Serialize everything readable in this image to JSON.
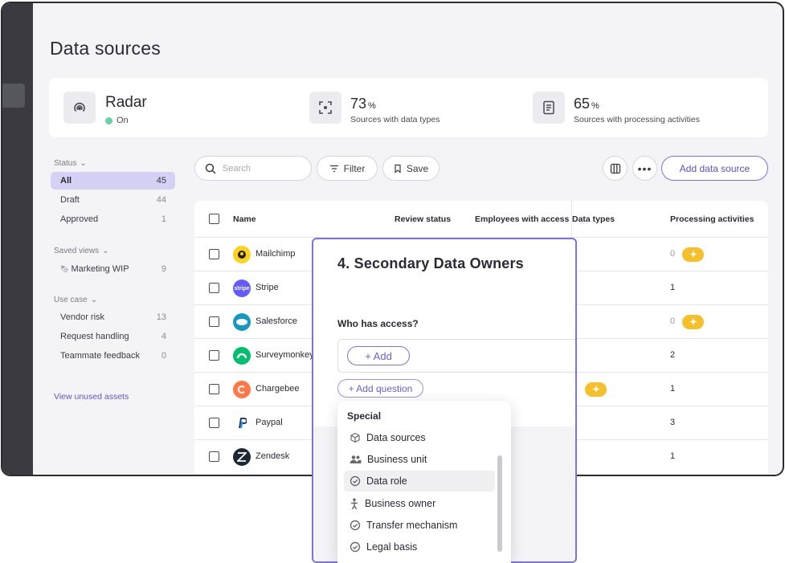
{
  "page": {
    "title": "Data sources"
  },
  "stats": {
    "radar": {
      "name": "Radar",
      "status": "On"
    },
    "data_types": {
      "value": "73",
      "unit": "%",
      "label": "Sources with data types"
    },
    "processing": {
      "value": "65",
      "unit": "%",
      "label": "Sources with processing activities"
    }
  },
  "sidebar": {
    "status": {
      "heading": "Status",
      "items": [
        {
          "label": "All",
          "count": "45"
        },
        {
          "label": "Draft",
          "count": "44"
        },
        {
          "label": "Approved",
          "count": "1"
        }
      ]
    },
    "saved_views": {
      "heading": "Saved views",
      "items": [
        {
          "label": "Marketing WIP",
          "count": "9"
        }
      ]
    },
    "use_case": {
      "heading": "Use case",
      "items": [
        {
          "label": "Vendor risk",
          "count": "13"
        },
        {
          "label": "Request handling",
          "count": "4"
        },
        {
          "label": "Teammate feedback",
          "count": "0"
        }
      ]
    },
    "view_unused": "View unused assets"
  },
  "toolbar": {
    "search_placeholder": "Search",
    "filter_label": "Filter",
    "save_label": "Save",
    "add_label": "Add data source"
  },
  "table": {
    "headers": {
      "name": "Name",
      "review_status": "Review status",
      "employees": "Employees with access",
      "data_types": "Data types",
      "processing": "Processing activities"
    },
    "rows": [
      {
        "name": "Mailchimp",
        "processing": "0",
        "logo_color": "#ffd21e"
      },
      {
        "name": "Stripe",
        "processing": "1",
        "logo_color": "#635bff",
        "logo_text": "stripe"
      },
      {
        "name": "Salesforce",
        "processing": "0",
        "logo_color": "#1798c1"
      },
      {
        "name": "Surveymonkey",
        "processing": "2",
        "logo_color": "#00bf6f"
      },
      {
        "name": "Chargebee",
        "processing": "1",
        "logo_color": "#ff7846"
      },
      {
        "name": "Paypal",
        "processing": "3",
        "logo_color": "#ffffff"
      },
      {
        "name": "Zendesk",
        "processing": "1",
        "logo_color": "#1f2933"
      }
    ]
  },
  "panel": {
    "title": "4. Secondary Data Owners",
    "question": "Who has access?",
    "add_label": "+ Add",
    "add_question_label": "+ Add question"
  },
  "dropdown": {
    "heading": "Special",
    "items": [
      {
        "label": "Data sources",
        "icon": "cube-icon"
      },
      {
        "label": "Business unit",
        "icon": "people-icon"
      },
      {
        "label": "Data role",
        "icon": "check-circle-icon"
      },
      {
        "label": "Business owner",
        "icon": "person-icon"
      },
      {
        "label": "Transfer mechanism",
        "icon": "check-circle-icon"
      },
      {
        "label": "Legal basis",
        "icon": "check-circle-icon"
      }
    ]
  },
  "colors": {
    "accent": "#7c72e0",
    "active_bg": "#d4d1f5",
    "status_on": "#67d3a6",
    "spark": "#f5c02c"
  }
}
